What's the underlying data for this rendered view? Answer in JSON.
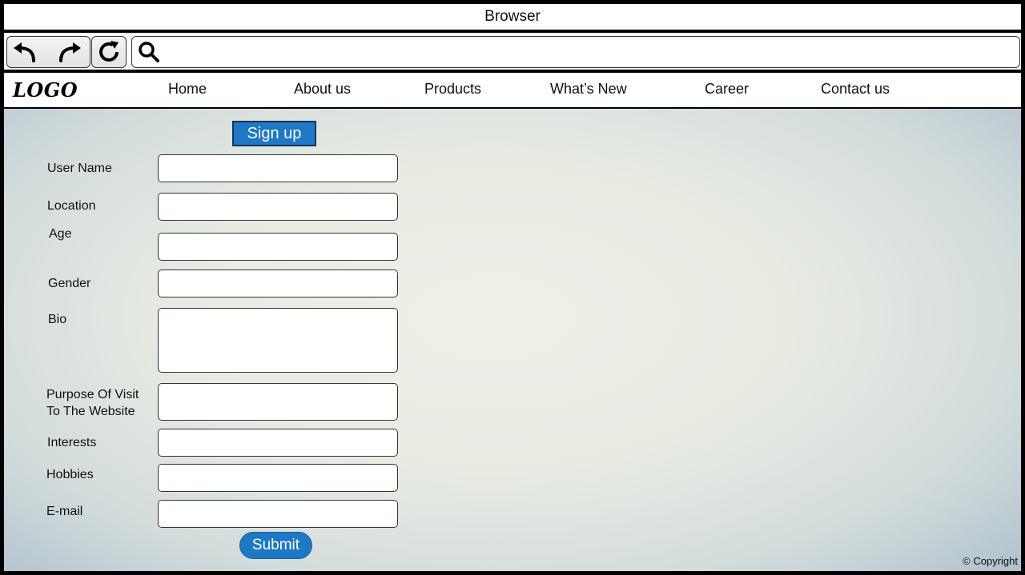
{
  "browser": {
    "title": "Browser",
    "address_value": "",
    "icons": [
      "back-arrow-icon",
      "forward-arrow-icon",
      "reload-icon",
      "search-icon"
    ]
  },
  "site": {
    "logo": "LOGO",
    "nav": [
      "Home",
      "About us",
      "Products",
      "What’s New",
      "Career",
      "Contact us"
    ]
  },
  "form": {
    "heading_button": "Sign up",
    "fields": [
      {
        "label": "User Name",
        "value": ""
      },
      {
        "label": "Location",
        "value": ""
      },
      {
        "label": "Age",
        "value": ""
      },
      {
        "label": "Gender",
        "value": ""
      },
      {
        "label": "Bio",
        "value": ""
      },
      {
        "label_lines": [
          "Purpose Of Visit",
          "To The Website"
        ],
        "value": ""
      },
      {
        "label": "Interests",
        "value": ""
      },
      {
        "label": "Hobbies",
        "value": ""
      },
      {
        "label": "E-mail",
        "value": ""
      }
    ],
    "submit_label": "Submit"
  },
  "footer": {
    "copyright": "© Copyright"
  },
  "colors": {
    "accent": "#1e78c4",
    "accent_border": "#12365a",
    "frame": "#000000"
  }
}
